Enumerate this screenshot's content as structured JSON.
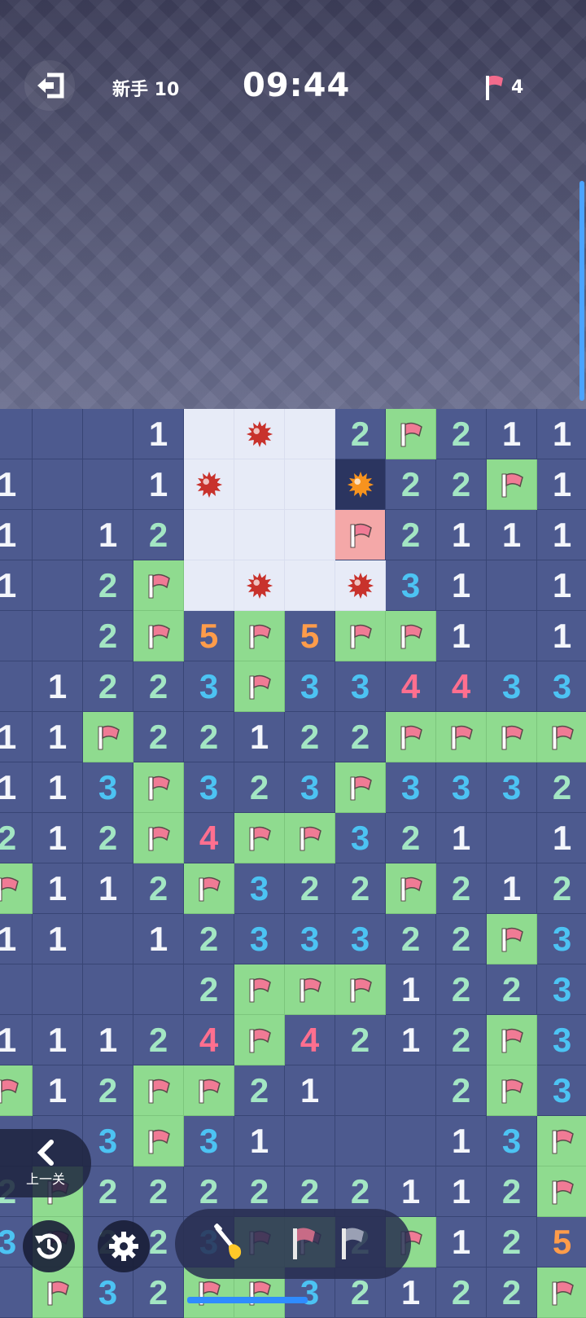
{
  "header": {
    "level_label": "新手 10",
    "timer": "09:44",
    "flags_remaining": "4"
  },
  "bottom": {
    "prev_level_label": "上一关"
  },
  "board": {
    "rows": [
      [
        "",
        "",
        "",
        "1",
        "O",
        "B",
        "O",
        "2",
        "F",
        "2",
        "1",
        "1"
      ],
      [
        "1",
        "",
        "",
        "1",
        "B",
        "O",
        "O",
        "X",
        "2",
        "2",
        "F",
        "1"
      ],
      [
        "1",
        "",
        "1",
        "2",
        "O",
        "O",
        "O",
        "W",
        "2",
        "1",
        "1",
        "1"
      ],
      [
        "1",
        "",
        "2",
        "F",
        "O",
        "B",
        "O",
        "B",
        "3",
        "1",
        "",
        "1"
      ],
      [
        "",
        "",
        "2",
        "F",
        "5",
        "F",
        "5",
        "F",
        "F",
        "1",
        "",
        "1"
      ],
      [
        "",
        "1",
        "2",
        "2",
        "3",
        "F",
        "3",
        "3",
        "4",
        "4",
        "3",
        "3"
      ],
      [
        "1",
        "1",
        "F",
        "2",
        "2",
        "1",
        "2",
        "2",
        "F",
        "F",
        "F",
        "F"
      ],
      [
        "1",
        "1",
        "3",
        "F",
        "3",
        "2",
        "3",
        "F",
        "3",
        "3",
        "3",
        "2"
      ],
      [
        "2",
        "1",
        "2",
        "F",
        "4",
        "F",
        "F",
        "3",
        "2",
        "1",
        "",
        "1"
      ],
      [
        "F",
        "1",
        "1",
        "2",
        "F",
        "3",
        "2",
        "2",
        "F",
        "2",
        "1",
        "2"
      ],
      [
        "1",
        "1",
        "",
        "1",
        "2",
        "3",
        "3",
        "3",
        "2",
        "2",
        "F",
        "3"
      ],
      [
        "",
        "",
        "",
        "",
        "2",
        "F",
        "F",
        "F",
        "1",
        "2",
        "2",
        "3"
      ],
      [
        "1",
        "1",
        "1",
        "2",
        "4",
        "F",
        "4",
        "2",
        "1",
        "2",
        "F",
        "3"
      ],
      [
        "F",
        "1",
        "2",
        "F",
        "F",
        "2",
        "1",
        "",
        "",
        "2",
        "F",
        "3"
      ],
      [
        "",
        "",
        "3",
        "F",
        "3",
        "1",
        "",
        "",
        "",
        "1",
        "3",
        "F"
      ],
      [
        "2",
        "F",
        "2",
        "2",
        "2",
        "2",
        "2",
        "2",
        "1",
        "1",
        "2",
        "F"
      ],
      [
        "3",
        "F",
        "2",
        "2",
        "3",
        "F",
        "F",
        "2",
        "F",
        "1",
        "2",
        "5"
      ],
      [
        "",
        "F",
        "3",
        "2",
        "F",
        "F",
        "3",
        "2",
        "1",
        "2",
        "2",
        "F"
      ]
    ]
  },
  "colors": {
    "accent": "#2f8cff",
    "flag_cell": "#8fdb8f",
    "board_bg": "#4d5a8f"
  },
  "icons": [
    "exit-icon",
    "flag-icon",
    "chevron-left-icon",
    "undo-icon",
    "gear-icon",
    "shovel-icon",
    "mine-icon"
  ]
}
